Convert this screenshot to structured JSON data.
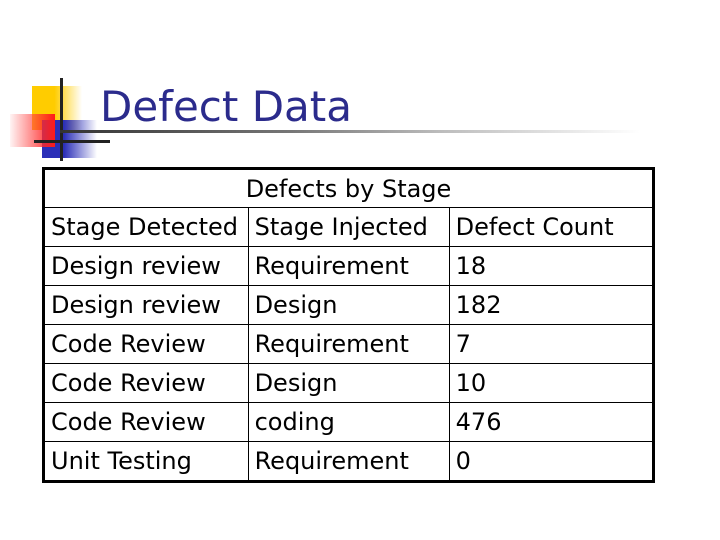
{
  "slide": {
    "title": "Defect Data",
    "logo_icon": "decorative-squares-logo",
    "colors": {
      "title": "#2b2b8c",
      "yellow": "#ffcc00",
      "blue": "#2b2fb8",
      "red": "#ff1a1a"
    }
  },
  "table": {
    "caption": "Defects by Stage",
    "columns": [
      "Stage Detected",
      "Stage Injected",
      "Defect Count"
    ],
    "rows": [
      [
        "Design review",
        "Requirement",
        "18"
      ],
      [
        "Design review",
        "Design",
        "182"
      ],
      [
        "Code Review",
        "Requirement",
        "7"
      ],
      [
        "Code Review",
        "Design",
        "10"
      ],
      [
        "Code Review",
        "coding",
        "476"
      ],
      [
        "Unit Testing",
        "Requirement",
        "0"
      ]
    ]
  }
}
